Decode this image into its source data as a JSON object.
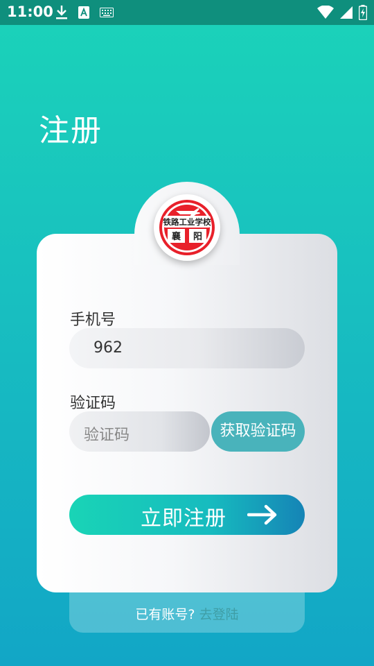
{
  "status_bar": {
    "time": "11:00"
  },
  "page": {
    "title": "注册"
  },
  "logo": {
    "school_name": "铁路工业学校",
    "city_left": "襄",
    "city_right": "阳"
  },
  "form": {
    "phone_label": "手机号",
    "phone_value": "962",
    "code_label": "验证码",
    "code_placeholder": "验证码",
    "get_code_button": "获取验证码",
    "register_button": "立即注册"
  },
  "footer": {
    "have_account": "已有账号?",
    "login_link": "去登陆"
  },
  "colors": {
    "accent": "#19d4b6",
    "button": "#49b3bb",
    "link": "#3f9ea6"
  }
}
